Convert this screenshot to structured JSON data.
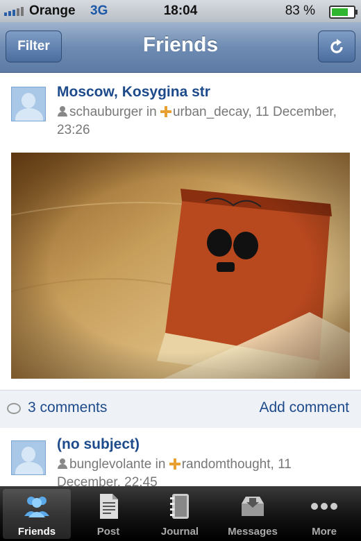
{
  "status_bar": {
    "carrier": "Orange",
    "network": "3G",
    "time": "18:04",
    "battery": "83 %"
  },
  "nav": {
    "title": "Friends",
    "filter_label": "Filter",
    "refresh_icon": "refresh-icon"
  },
  "posts": [
    {
      "subject": "Moscow, Kosygina str",
      "author": "schauburger",
      "in_word": "in",
      "community": "urban_decay",
      "date": ", 11 December, 23:26",
      "comments": "3 comments",
      "add_comment": "Add comment"
    },
    {
      "subject": "(no subject)",
      "author": "bunglevolante",
      "in_word": "in",
      "community": "randomthought",
      "date": ", 11 December, 22:45"
    }
  ],
  "tabs": [
    {
      "label": "Friends",
      "icon": "friends-icon",
      "active": true
    },
    {
      "label": "Post",
      "icon": "post-icon"
    },
    {
      "label": "Journal",
      "icon": "journal-icon"
    },
    {
      "label": "Messages",
      "icon": "messages-icon"
    },
    {
      "label": "More",
      "icon": "more-icon"
    }
  ],
  "colors": {
    "nav": "#6e8bb2",
    "link": "#1d4a8a",
    "tabbar": "#151515"
  }
}
